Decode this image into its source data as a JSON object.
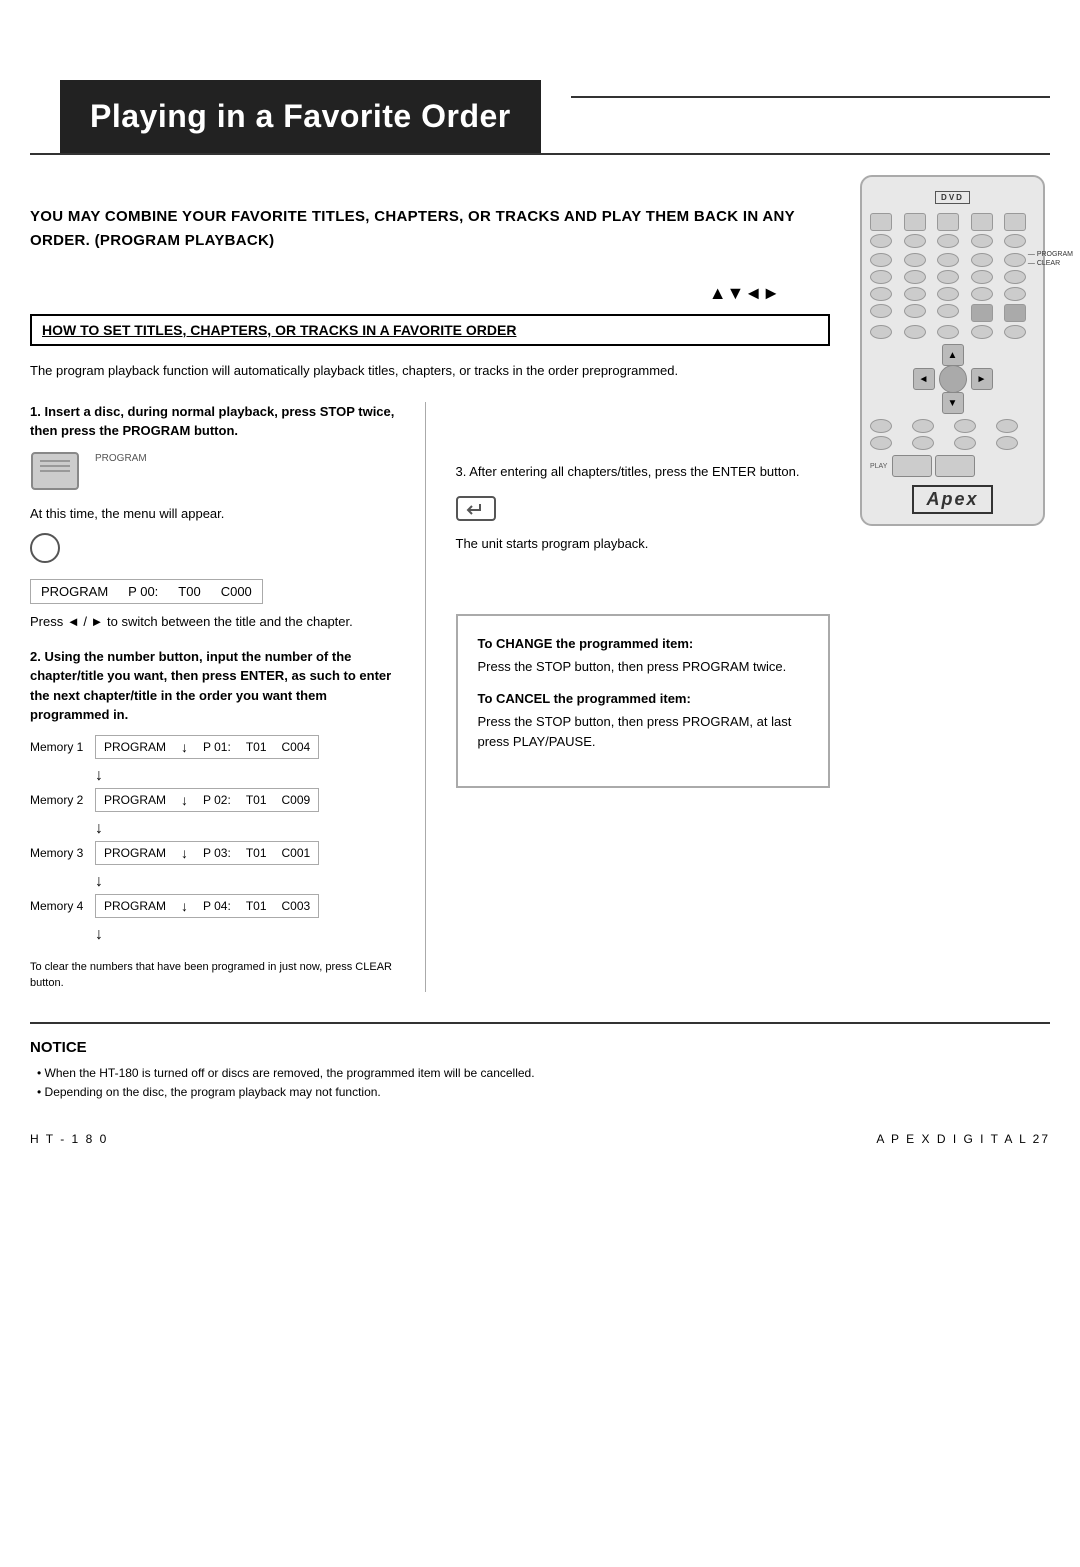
{
  "page": {
    "title": "Playing in a Favorite Order",
    "intro_text": "YOU MAY COMBINE YOUR FAVORITE TITLES, CHAPTERS, OR TRACKS AND PLAY THEM BACK IN ANY ORDER. (PROGRAM PLAYBACK)",
    "section_heading": "HOW TO SET TITLES, CHAPTERS, OR TRACKS IN A FAVORITE ORDER",
    "section_desc": "The program playback function will automatically playback titles, chapters, or tracks in the order preprogrammed.",
    "step1_bold": "1. Insert a disc, during normal playback, press STOP twice, then press the PROGRAM button.",
    "step1_note": "At this time, the menu will appear.",
    "step1_program_label": "PROGRAM",
    "program_display": {
      "label": "PROGRAM",
      "p": "P 00:",
      "t": "T00",
      "c": "C000"
    },
    "step1_switch_text": "Press ◄ / ► to switch between the title and the chapter.",
    "step2_bold": "2. Using the number button, input the number of the chapter/title you want, then press ENTER, as such to enter the next chapter/title in the order you want them programmed in.",
    "memories": [
      {
        "label": "Memory 1",
        "p": "P 01:",
        "t": "T01",
        "c": "C004"
      },
      {
        "label": "Memory 2",
        "p": "P 02:",
        "t": "T01",
        "c": "C009"
      },
      {
        "label": "Memory 3",
        "p": "P 03:",
        "t": "T01",
        "c": "C001"
      },
      {
        "label": "Memory 4",
        "p": "P 04:",
        "t": "T01",
        "c": "C003"
      }
    ],
    "clear_note": "To clear the numbers that have been programed in just now, press CLEAR button.",
    "step3_text": "3. After entering all chapters/titles, press the ENTER button.",
    "step3_note": "The unit starts program playback.",
    "info_box": {
      "change_title": "To CHANGE the programmed item:",
      "change_text": "Press the STOP button, then press PROGRAM twice.",
      "cancel_title": "To CANCEL the programmed item:",
      "cancel_text": "Press the STOP button, then press PROGRAM, at last press PLAY/PAUSE."
    },
    "notice": {
      "title": "NOTICE",
      "items": [
        "When the HT-180 is turned off or discs are removed, the programmed item will be cancelled.",
        "Depending on the disc, the program playback may not function."
      ]
    },
    "footer": {
      "left": "H T - 1 8 0",
      "right": "A P E X   D I G I T A L   27"
    },
    "remote": {
      "brand": "DVD",
      "labels": {
        "program": "PROGRAM",
        "clear": "CLEAR",
        "play": "PLAY"
      }
    },
    "arrows_indicator": "▲▼◄►"
  }
}
